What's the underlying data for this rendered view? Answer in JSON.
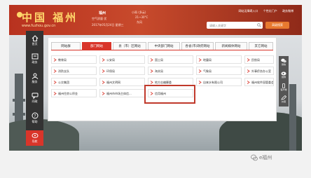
{
  "header": {
    "logo_text": "中国 福州",
    "logo_url": "www.fuzhou.gov.cn",
    "city": "福州",
    "weather_1": "空气质量 优",
    "date": "2017年05月24日 星期三",
    "weather_2": "小雨 (多云)",
    "temp": "21~30°C",
    "wind": "东风",
    "links": [
      "网站无障碍入口",
      "个性化门户",
      "政务微博"
    ],
    "search_placeholder": "请输入关键字",
    "search_button": "高级搜索"
  },
  "left_nav": [
    {
      "label": "首页",
      "icon": "home-icon"
    },
    {
      "label": "政务",
      "icon": "government-icon"
    },
    {
      "label": "服务",
      "icon": "service-icon"
    },
    {
      "label": "问政",
      "icon": "chat-icon"
    },
    {
      "label": "帮助",
      "icon": "help-icon"
    },
    {
      "label": "导航",
      "icon": "navigation-icon"
    }
  ],
  "right_nav": [
    {
      "label": "微信",
      "icon": "wechat-icon"
    },
    {
      "label": "微博",
      "icon": "weibo-icon"
    },
    {
      "label": "客户端",
      "icon": "mobile-app-icon"
    },
    {
      "label": "纠错",
      "icon": "edit-icon"
    }
  ],
  "tabs": [
    "网站群",
    "部门网站",
    "县（市）区网站",
    "中央部门网站",
    "各省(市)政府网站",
    "新闻媒体网站",
    "其它网站"
  ],
  "active_tab": "部门网站",
  "dept_sites": [
    [
      "教育局",
      "公安局",
      "国土局",
      "地震局",
      "民航局"
    ],
    [
      "消防支队",
      "环保局",
      "海关局",
      "气象局",
      "外事侨务办公室"
    ],
    [
      "公交集团",
      "福州文明网",
      "地方志编纂委",
      "自来水有限公司",
      "福州软件园管委会"
    ],
    [
      "福州住房公积金",
      "福州市市场主体信...",
      "信用福州"
    ]
  ],
  "highlighted_site": "信用福州",
  "watermark": "e福州"
}
